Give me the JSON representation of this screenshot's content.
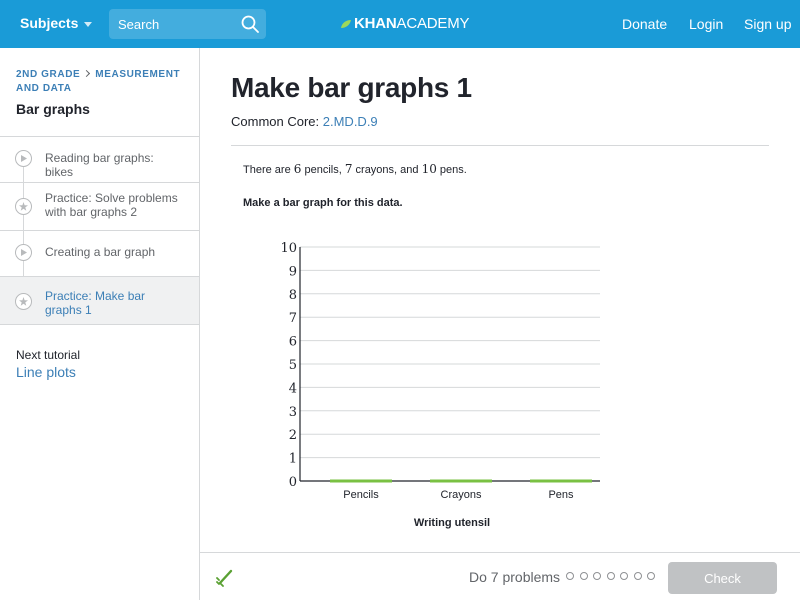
{
  "header": {
    "subjects_label": "Subjects",
    "search_placeholder": "Search",
    "logo_bold": "KHAN",
    "logo_rest": "ACADEMY",
    "nav": {
      "donate": "Donate",
      "login": "Login",
      "signup": "Sign up"
    }
  },
  "sidebar": {
    "crumb_1": "2ND GRADE",
    "crumb_2": "MEASUREMENT AND DATA",
    "title": "Bar graphs",
    "items": [
      {
        "label": "Reading bar graphs: bikes",
        "icon": "play-icon"
      },
      {
        "label": "Practice: Solve problems with bar graphs 2",
        "icon": "star-icon"
      },
      {
        "label": "Creating a bar graph",
        "icon": "play-icon"
      },
      {
        "label": "Practice: Make bar graphs 1",
        "icon": "star-icon",
        "selected": true
      }
    ],
    "next_label": "Next tutorial",
    "next_value": "Line plots"
  },
  "main": {
    "title": "Make bar graphs 1",
    "cc_label": "Common Core:",
    "cc_code": "2.MD.D.9",
    "q_prefix": "There are",
    "q_n1": "6",
    "q_t1": "pencils,",
    "q_n2": "7",
    "q_t2": "crayons, and",
    "q_n3": "10",
    "q_t3": "pens.",
    "instruction": "Make a bar graph for this data."
  },
  "chart_data": {
    "type": "bar",
    "categories": [
      "Pencils",
      "Crayons",
      "Pens"
    ],
    "values": [
      0,
      0,
      0
    ],
    "xlabel": "Writing utensil",
    "ylabel": "",
    "ylim": [
      0,
      10
    ],
    "yticks": [
      "0",
      "1",
      "2",
      "3",
      "4",
      "5",
      "6",
      "7",
      "8",
      "9",
      "10"
    ],
    "bar_color": "#7ac143",
    "grid": true
  },
  "footer": {
    "do_label": "Do 7 problems",
    "dot_count": 7,
    "check_label": "Check"
  },
  "colors": {
    "header": "#1a9bd7",
    "link": "#3c7fb6",
    "bar": "#7ac143"
  }
}
